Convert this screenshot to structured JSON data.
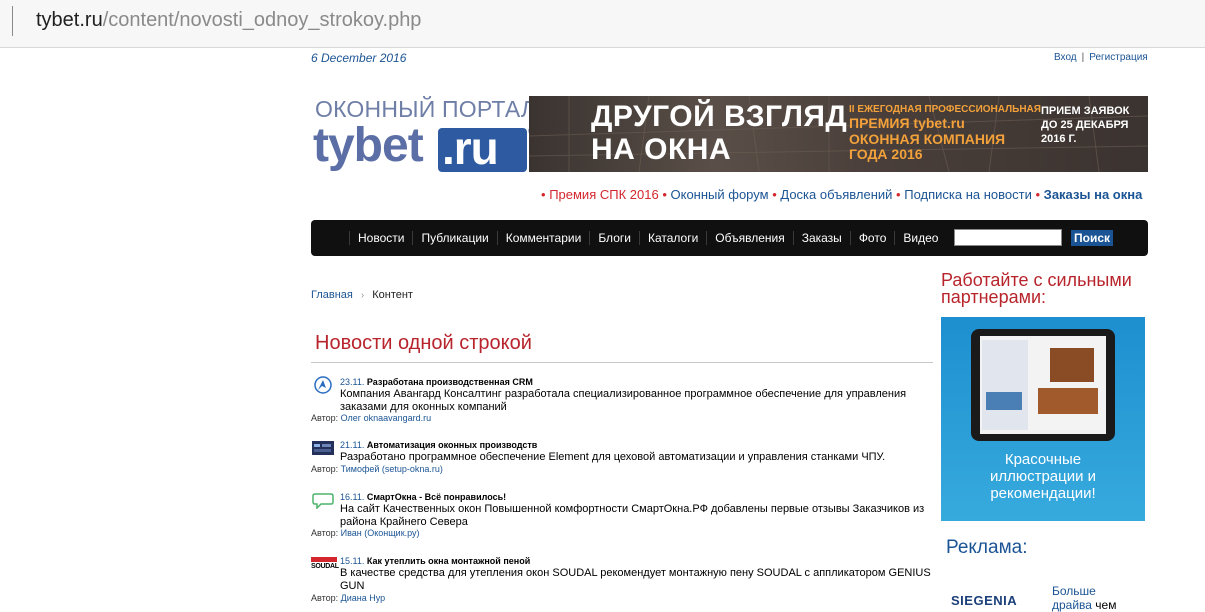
{
  "browser": {
    "url_host": "tybet.ru",
    "url_path": "/content/novosti_odnoy_strokoy.php"
  },
  "header": {
    "date": "6 December 2016",
    "login": "Вход",
    "auth_sep": "|",
    "register": "Регистрация",
    "logo_top": "ОКОННЫЙ ПОРТАЛ",
    "logo_name": "tybet",
    "logo_tld": ".ru",
    "logo_reg": "®"
  },
  "banner": {
    "headline_1": "ДРУГОЙ ВЗГЛЯД",
    "headline_2": "НА ОКНА",
    "premium_1": "II ЕЖЕГОДНАЯ ПРОФЕССИОНАЛЬНАЯ",
    "premium_2": "ПРЕМИЯ tybet.ru",
    "premium_3": "ОКОННАЯ КОМПАНИЯ",
    "premium_4": "ГОДА 2016",
    "deadline_1": "ПРИЕМ ЗАЯВОК",
    "deadline_2": "ДО 25 ДЕКАБРЯ",
    "deadline_3": "2016 Г."
  },
  "toplinks": {
    "bullet": "•",
    "items": [
      "Премия СПК 2016",
      "Оконный форум",
      "Доска объявлений",
      "Подписка на новости",
      "Заказы на окна"
    ]
  },
  "nav": {
    "items": [
      "Новости",
      "Публикации",
      "Комментарии",
      "Блоги",
      "Каталоги",
      "Объявления",
      "Заказы",
      "Фото",
      "Видео"
    ],
    "search_value": "",
    "search_button": "Поиск"
  },
  "breadcrumb": {
    "home": "Главная",
    "arrow": "›",
    "current": "Контент"
  },
  "page_title": "Новости одной строкой",
  "news": [
    {
      "date": "23.11.",
      "headline": "Разработана производственная CRM",
      "text": "Компания Авангард Консалтинг разработала специализированное программное обеспечение для управления заказами для оконных компаний",
      "author_label": "Автор:",
      "author": "Олег oknaavangard.ru",
      "icon": "avangard-logo-icon"
    },
    {
      "date": "21.11.",
      "headline": "Автоматизация оконных производств",
      "text": "Разработано программное обеспечение Element для цеховой автоматизации и управления станками ЧПУ.",
      "author_label": "Автор:",
      "author": "Тимофей (setup-okna.ru)",
      "icon": "element-software-icon"
    },
    {
      "date": "16.11.",
      "headline": "СмартОкна - Всё понравилось!",
      "text": "На сайт Качественных окон Повышенной комфортности СмартОкна.РФ добавлены первые отзывы Заказчиков из района Крайнего Севера",
      "author_label": "Автор:",
      "author": "Иван (Оконщик.ру)",
      "icon": "speech-bubble-icon"
    },
    {
      "date": "15.11.",
      "headline": "Как утеплить окна монтажной пеной",
      "text": "В качестве средства для утепления окон SOUDAL рекомендует монтажную пену SOUDAL с аппликатором GENIUS GUN",
      "author_label": "Автор:",
      "author": "Диана Нур",
      "icon": "soudal-logo-icon",
      "icon_text": "SOUDAL"
    }
  ],
  "sidebar": {
    "partners_title_1": "Работайте с сильными",
    "partners_title_2": "партнерами:",
    "partner_caption_1": "Красочные",
    "partner_caption_2": "иллюстрации и",
    "partner_caption_3": "рекомендации!",
    "ad_title": "Реклама:",
    "ad_logo": "SIEGENIA",
    "ad_link_1": "Больше",
    "ad_link_2": "драйва",
    "ad_rest": " чем"
  },
  "colors": {
    "brand_blue": "#1b5494",
    "accent_red": "#b8242b",
    "nav_bg": "#101010",
    "banner_orange": "#f3a13a"
  }
}
